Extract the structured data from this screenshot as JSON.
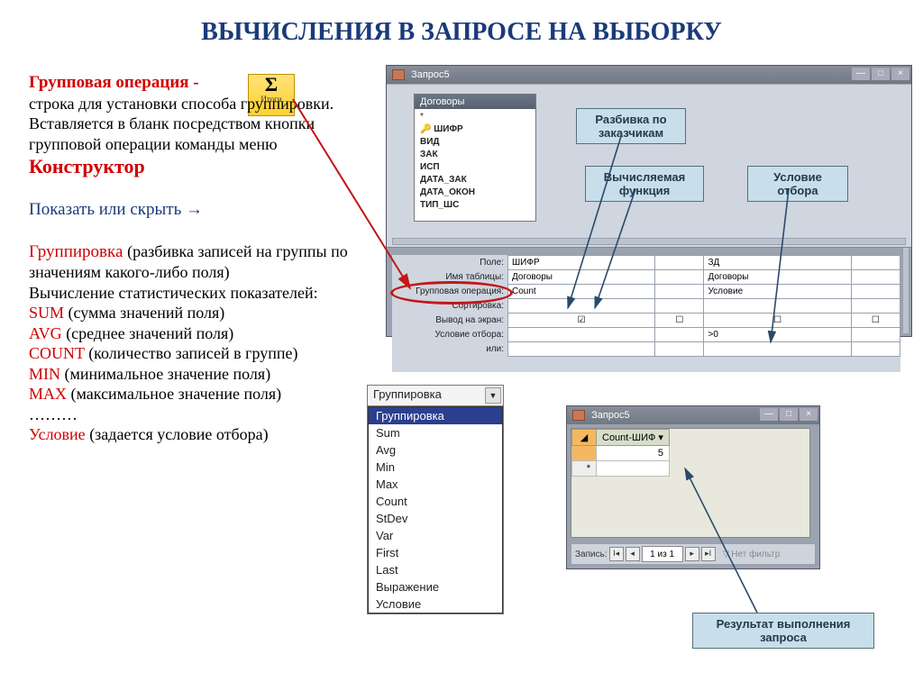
{
  "title": "ВЫЧИСЛЕНИЯ В ЗАПРОСЕ НА ВЫБОРКУ",
  "totals_button": {
    "symbol": "Σ",
    "label": "Итоги"
  },
  "text": {
    "group_op_head": "Групповая операция -",
    "group_op_desc": "строка для установки способа группировки.",
    "insert1": "Вставляется в бланк посредством кнопки групповой операции команды меню ",
    "constructor": "Конструктор",
    "show_hide": "Показать или скрыть →",
    "grouping_head": "Группировка ",
    "grouping_desc": "(разбивка записей на группы по значениям какого-либо поля)",
    "stats_intro": "Вычисление статистических показателей:",
    "sum": "SUM ",
    "sum_d": "(сумма значений поля)",
    "avg": "AVG ",
    "avg_d": "(среднее значений поля)",
    "count": "COUNT ",
    "count_d": "(количество записей в группе)",
    "min": "MIN ",
    "min_d": "(минимальное значение поля)",
    "max": "MAX ",
    "max_d": "(максимальное значение поля)",
    "dots": "………",
    "cond": "Условие ",
    "cond_d": "(задается условие отбора)"
  },
  "qwin": {
    "title": "Запрос5",
    "table": {
      "title": "Договоры",
      "fields": [
        "*",
        "ШИФР",
        "ВИД",
        "ЗАК",
        "ИСП",
        "ДАТА_ЗАК",
        "ДАТА_ОКОН",
        "ТИП_ШС"
      ]
    },
    "callouts": {
      "c1": "Разбивка по заказчикам",
      "c2": "Вычисляемая функция",
      "c3": "Условие отбора"
    },
    "grid_labels": {
      "field": "Поле:",
      "table": "Имя таблицы:",
      "groupop": "Групповая операция:",
      "sort": "Сортировка:",
      "show": "Вывод на экран:",
      "criteria": "Условие отбора:",
      "or": "или:"
    },
    "cols": [
      {
        "field": "ШИФР",
        "table": "Договоры",
        "groupop": "Count",
        "show": true,
        "criteria": ""
      },
      {
        "field": "ЗД",
        "table": "Договоры",
        "groupop": "Условие",
        "show": false,
        "criteria": ">0"
      }
    ]
  },
  "dropdown": {
    "selected_top": "Группировка",
    "items": [
      "Группировка",
      "Sum",
      "Avg",
      "Min",
      "Max",
      "Count",
      "StDev",
      "Var",
      "First",
      "Last",
      "Выражение",
      "Условие"
    ]
  },
  "rwin": {
    "title": "Запрос5",
    "col": "Count-ШИФ",
    "value": "5",
    "nav": "1 из 1",
    "nav_label": "Запись:",
    "filter": "Нет фильтр"
  },
  "result_callout": "Результат выполнения запроса"
}
